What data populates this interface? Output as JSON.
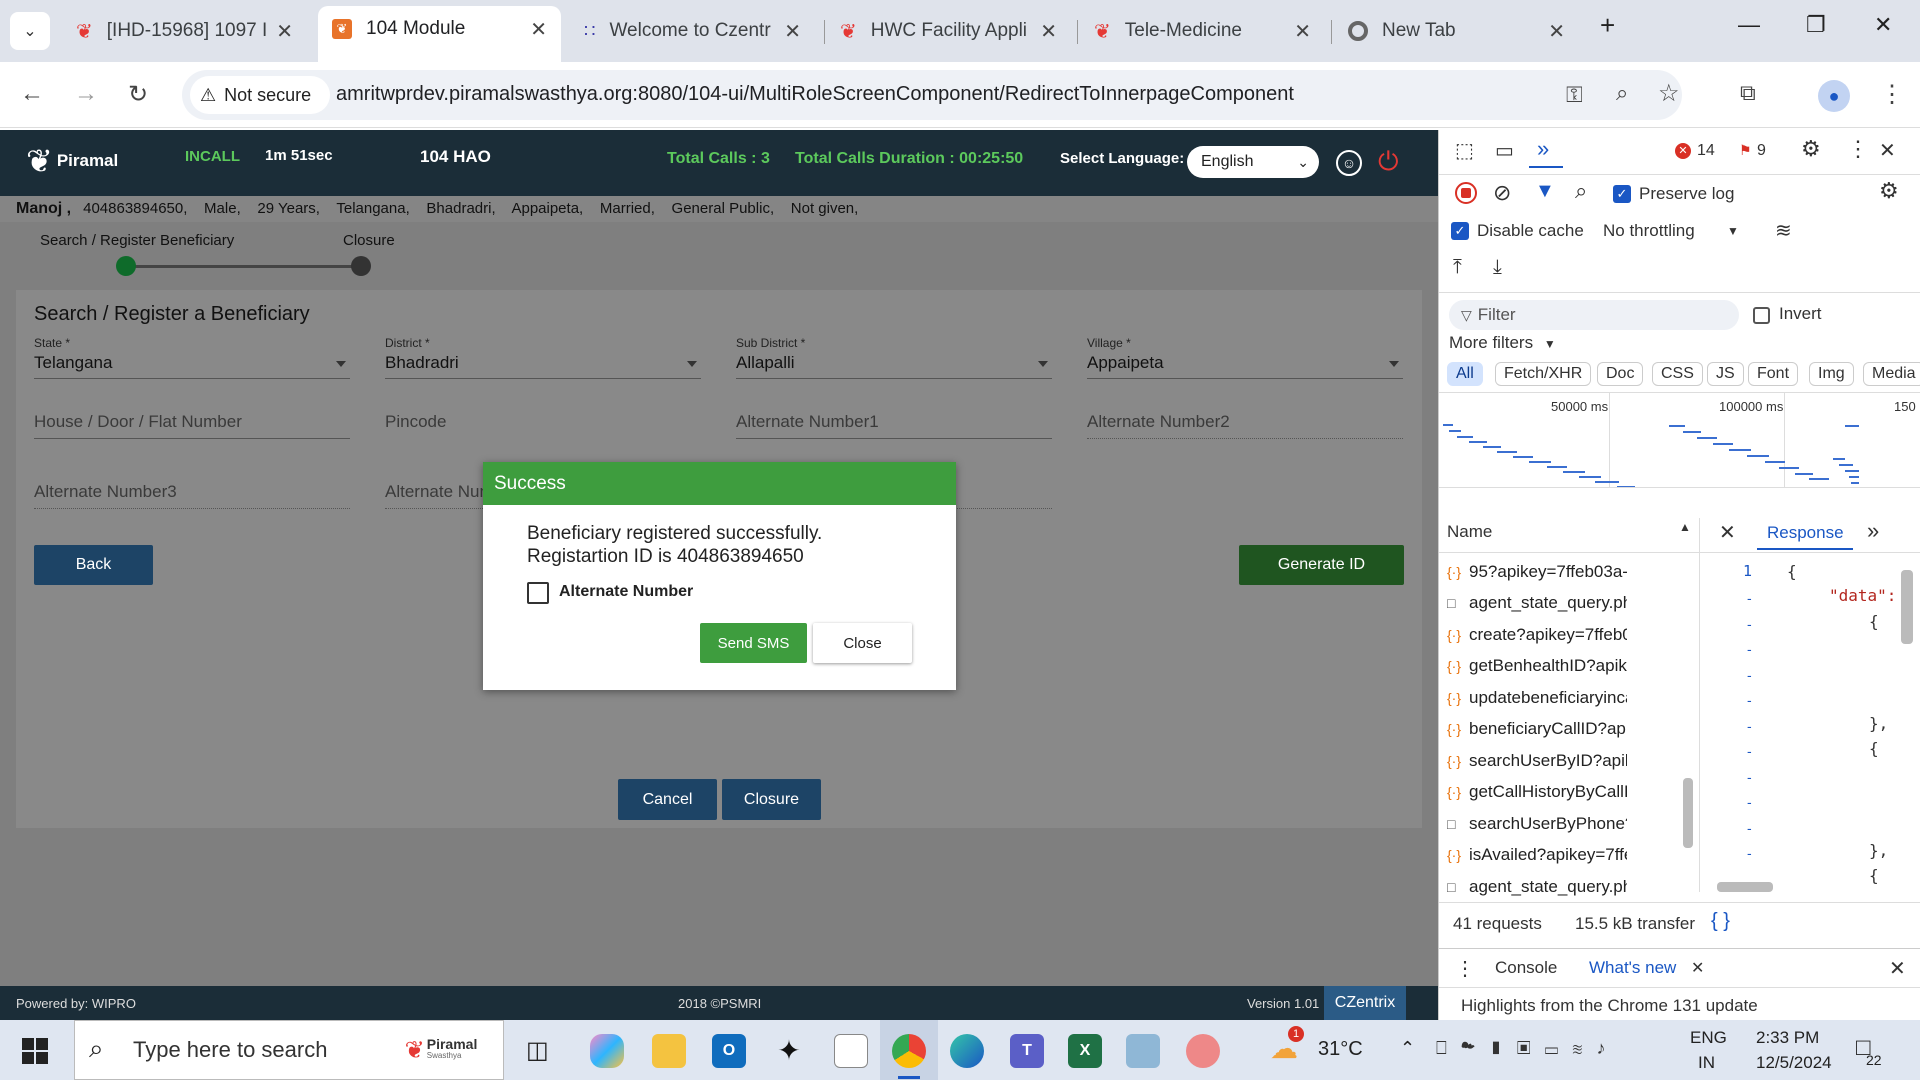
{
  "browser": {
    "tabs": [
      {
        "label": "[IHD-15968] 1097 I",
        "active": false
      },
      {
        "label": "104 Module",
        "active": true
      },
      {
        "label": "Welcome to Czentr",
        "active": false
      },
      {
        "label": "HWC Facility Appli",
        "active": false
      },
      {
        "label": "Tele-Medicine",
        "active": false
      },
      {
        "label": "New Tab",
        "active": false
      }
    ],
    "security_label": "Not secure",
    "url": "amritwprdev.piramalswasthya.org:8080/104-ui/MultiRoleScreenComponent/RedirectToInnerpageComponent"
  },
  "header": {
    "logo_text": "Piramal",
    "call_status": "INCALL",
    "call_timer": "1m 51sec",
    "role": "104 HAO",
    "total_calls": "Total Calls : 3",
    "total_duration": "Total Calls Duration : 00:25:50",
    "language_label": "Select Language:",
    "language_value": "English"
  },
  "beneficiary": {
    "name": "Manoj ,",
    "details": "404863894650,    Male,    29 Years,    Telangana,    Bhadradri,    Appaipeta,    Married,    General Public,    Not given,"
  },
  "stepper": {
    "step1": "Search / Register Beneficiary",
    "step2": "Closure"
  },
  "form": {
    "title": "Search / Register a Beneficiary",
    "state_label": "State *",
    "state_value": "Telangana",
    "district_label": "District *",
    "district_value": "Bhadradri",
    "subdistrict_label": "Sub District *",
    "subdistrict_value": "Allapalli",
    "village_label": "Village *",
    "village_value": "Appaipeta",
    "house_ph": "House / Door / Flat Number",
    "pincode_ph": "Pincode",
    "alt1_ph": "Alternate Number1",
    "alt2_ph": "Alternate Number2",
    "alt3_ph": "Alternate Number3",
    "alt4_ph": "Alternate Num",
    "back_label": "Back",
    "generate_label": "Generate ID",
    "cancel_label": "Cancel",
    "closure_label": "Closure"
  },
  "dialog": {
    "title": "Success",
    "line1": "Beneficiary registered successfully.",
    "line2": "Registartion ID is 404863894650",
    "checkbox_label": "Alternate Number",
    "send_sms_label": "Send SMS",
    "close_label": "Close"
  },
  "footer": {
    "powered": "Powered by: WIPRO",
    "copyright": "2018 ©PSMRI",
    "version": "Version 1.01",
    "brand": "CZentrix"
  },
  "devtools": {
    "errors": "14",
    "warnings": "9",
    "preserve_log": "Preserve log",
    "disable_cache": "Disable cache",
    "throttling": "No throttling",
    "filter_ph": "Filter",
    "invert": "Invert",
    "more_filters": "More filters",
    "type_tabs": [
      "All",
      "Fetch/XHR",
      "Doc",
      "CSS",
      "JS",
      "Font",
      "Img",
      "Media"
    ],
    "timeline_labels": [
      "50000 ms",
      "100000 ms",
      "150"
    ],
    "name_header": "Name",
    "response_tab": "Response",
    "requests": [
      {
        "name": "95?apikey=7ffeb03a-f4...",
        "type": "xhr"
      },
      {
        "name": "agent_state_query.php...",
        "type": "doc"
      },
      {
        "name": "create?apikey=7ffeb03...",
        "type": "xhr"
      },
      {
        "name": "getBenhealthID?apikey...",
        "type": "xhr"
      },
      {
        "name": "updatebeneficiaryincall...",
        "type": "xhr"
      },
      {
        "name": "beneficiaryCallID?apik...",
        "type": "xhr"
      },
      {
        "name": "searchUserByID?apikey...",
        "type": "xhr"
      },
      {
        "name": "getCallHistoryByCallID...",
        "type": "xhr"
      },
      {
        "name": "searchUserByPhone?a...",
        "type": "doc"
      },
      {
        "name": "isAvailed?apikey=7ffeb...",
        "type": "xhr"
      },
      {
        "name": "agent_state_query.php...",
        "type": "doc"
      }
    ],
    "response_lines": [
      "1",
      "{",
      "\"data\":",
      "{",
      "},",
      "{",
      "},",
      "{"
    ],
    "summary_requests": "41 requests",
    "summary_transfer": "15.5 kB transfer",
    "drawer_console": "Console",
    "drawer_whatsnew": "What's new",
    "highlights": "Highlights from the Chrome 131 update"
  },
  "taskbar": {
    "search_ph": "Type here to search",
    "search_brand": "Piramal",
    "search_brand_sub": "Swasthya",
    "weather": "31°C",
    "lang1": "ENG",
    "lang2": "IN",
    "time": "2:33 PM",
    "date": "12/5/2024",
    "notif_badge": "1",
    "notif_count": "22"
  }
}
